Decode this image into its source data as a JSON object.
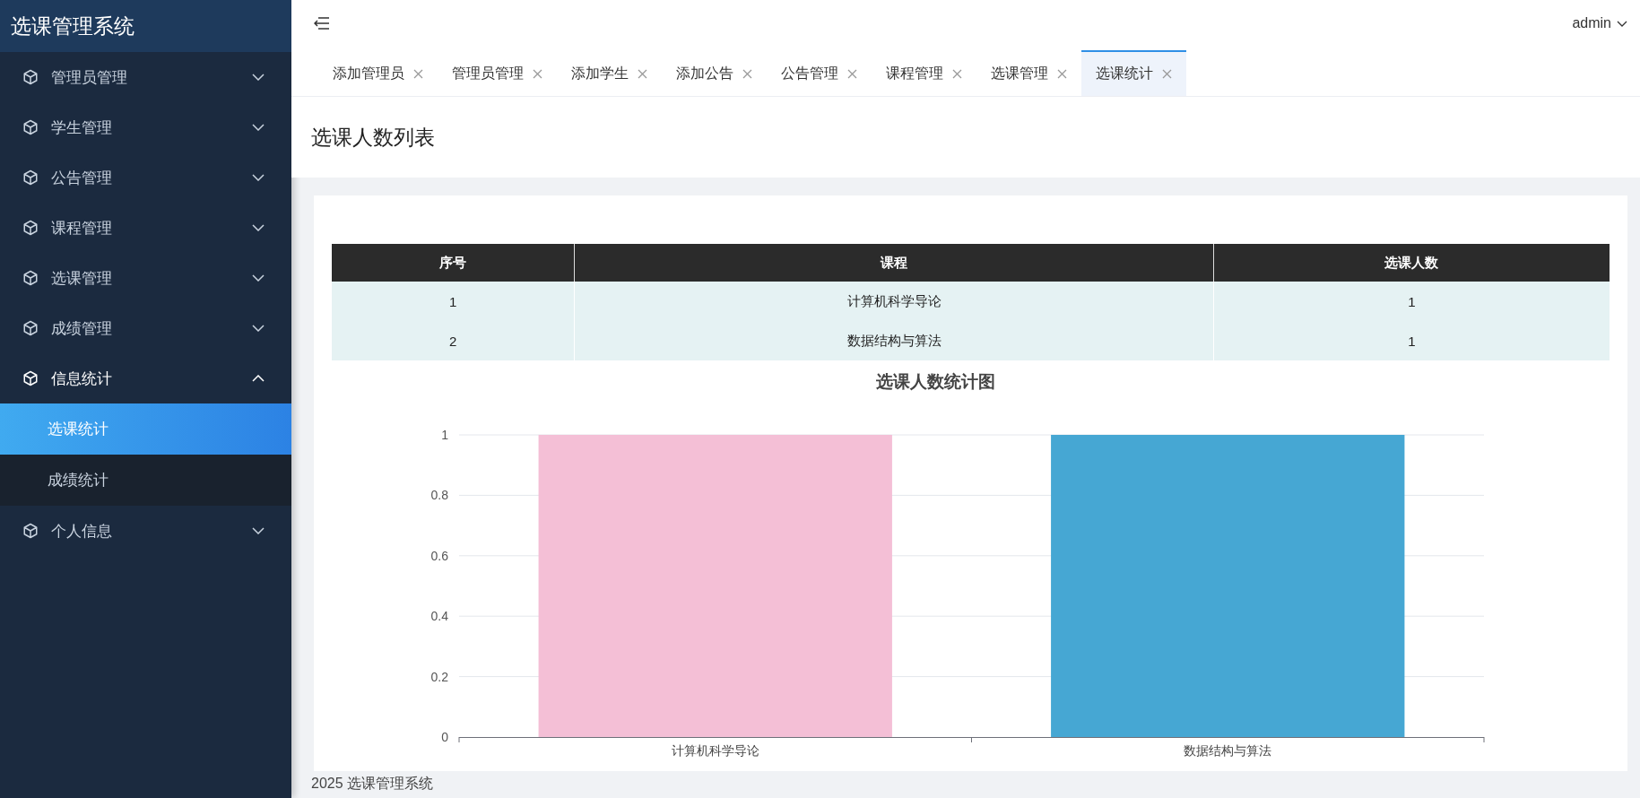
{
  "app": {
    "title": "选课管理系统"
  },
  "sidebar": {
    "items": [
      {
        "label": "管理员管理",
        "expanded": false
      },
      {
        "label": "学生管理",
        "expanded": false
      },
      {
        "label": "公告管理",
        "expanded": false
      },
      {
        "label": "课程管理",
        "expanded": false
      },
      {
        "label": "选课管理",
        "expanded": false
      },
      {
        "label": "成绩管理",
        "expanded": false
      },
      {
        "label": "信息统计",
        "expanded": true,
        "children": [
          {
            "label": "选课统计",
            "selected": true
          },
          {
            "label": "成绩统计",
            "selected": false
          }
        ]
      },
      {
        "label": "个人信息",
        "expanded": false
      }
    ]
  },
  "topbar": {
    "user": "admin"
  },
  "tabs": [
    {
      "label": "添加管理员",
      "selected": false
    },
    {
      "label": "管理员管理",
      "selected": false
    },
    {
      "label": "添加学生",
      "selected": false
    },
    {
      "label": "添加公告",
      "selected": false
    },
    {
      "label": "公告管理",
      "selected": false
    },
    {
      "label": "课程管理",
      "selected": false
    },
    {
      "label": "选课管理",
      "selected": false
    },
    {
      "label": "选课统计",
      "selected": true
    }
  ],
  "page": {
    "title": "选课人数列表"
  },
  "table": {
    "columns": [
      "序号",
      "课程",
      "选课人数"
    ],
    "rows": [
      [
        "1",
        "计算机科学导论",
        "1"
      ],
      [
        "2",
        "数据结构与算法",
        "1"
      ]
    ]
  },
  "chart": {
    "title": "选课人数统计图",
    "chart_data": {
      "type": "bar",
      "stacked": true,
      "grid": true,
      "categories": [
        "计算机科学导论",
        "数据结构与算法"
      ],
      "series": [
        {
          "color": "#f4bfd6",
          "values": [
            1,
            null
          ]
        },
        {
          "color": "#46a7d3",
          "values": [
            null,
            1
          ]
        }
      ],
      "ylim": [
        0,
        1
      ],
      "yticks": [
        0,
        0.2,
        0.4,
        0.6,
        0.8,
        1
      ]
    }
  },
  "footer": {
    "text": "2025 选课管理系统"
  }
}
